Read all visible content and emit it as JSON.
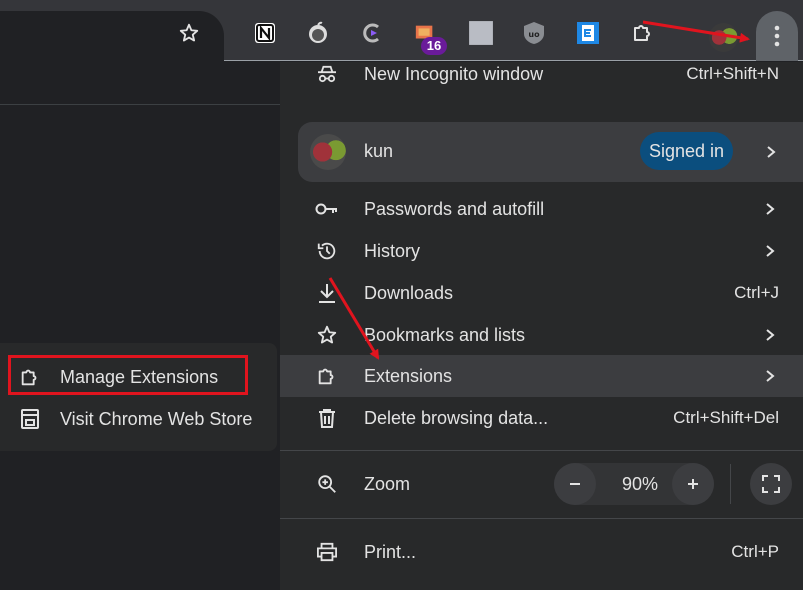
{
  "toolbar": {
    "extension_badge": "16",
    "icons": [
      "star-icon",
      "notion-icon",
      "extension-icon-2",
      "cursor-c-icon",
      "folder-extension-icon",
      "gray-square-extension-icon",
      "ublock-icon",
      "e-extension-icon",
      "puzzle-icon",
      "profile-avatar",
      "more-menu-icon"
    ]
  },
  "menu": {
    "new_incognito": {
      "label": "New Incognito window",
      "shortcut": "Ctrl+Shift+N"
    },
    "profile": {
      "name": "kun",
      "status": "Signed in"
    },
    "passwords": {
      "label": "Passwords and autofill"
    },
    "history": {
      "label": "History"
    },
    "downloads": {
      "label": "Downloads",
      "shortcut": "Ctrl+J"
    },
    "bookmarks": {
      "label": "Bookmarks and lists"
    },
    "extensions": {
      "label": "Extensions"
    },
    "delete_data": {
      "label": "Delete browsing data...",
      "shortcut": "Ctrl+Shift+Del"
    },
    "zoom": {
      "label": "Zoom",
      "value": "90%"
    },
    "print": {
      "label": "Print...",
      "shortcut": "Ctrl+P"
    }
  },
  "submenu": {
    "manage": {
      "label": "Manage Extensions"
    },
    "store": {
      "label": "Visit Chrome Web Store"
    }
  },
  "colors": {
    "accent_red": "#e0141e",
    "signed_in": "#0b4e7e",
    "menu_bg": "#28292a"
  }
}
